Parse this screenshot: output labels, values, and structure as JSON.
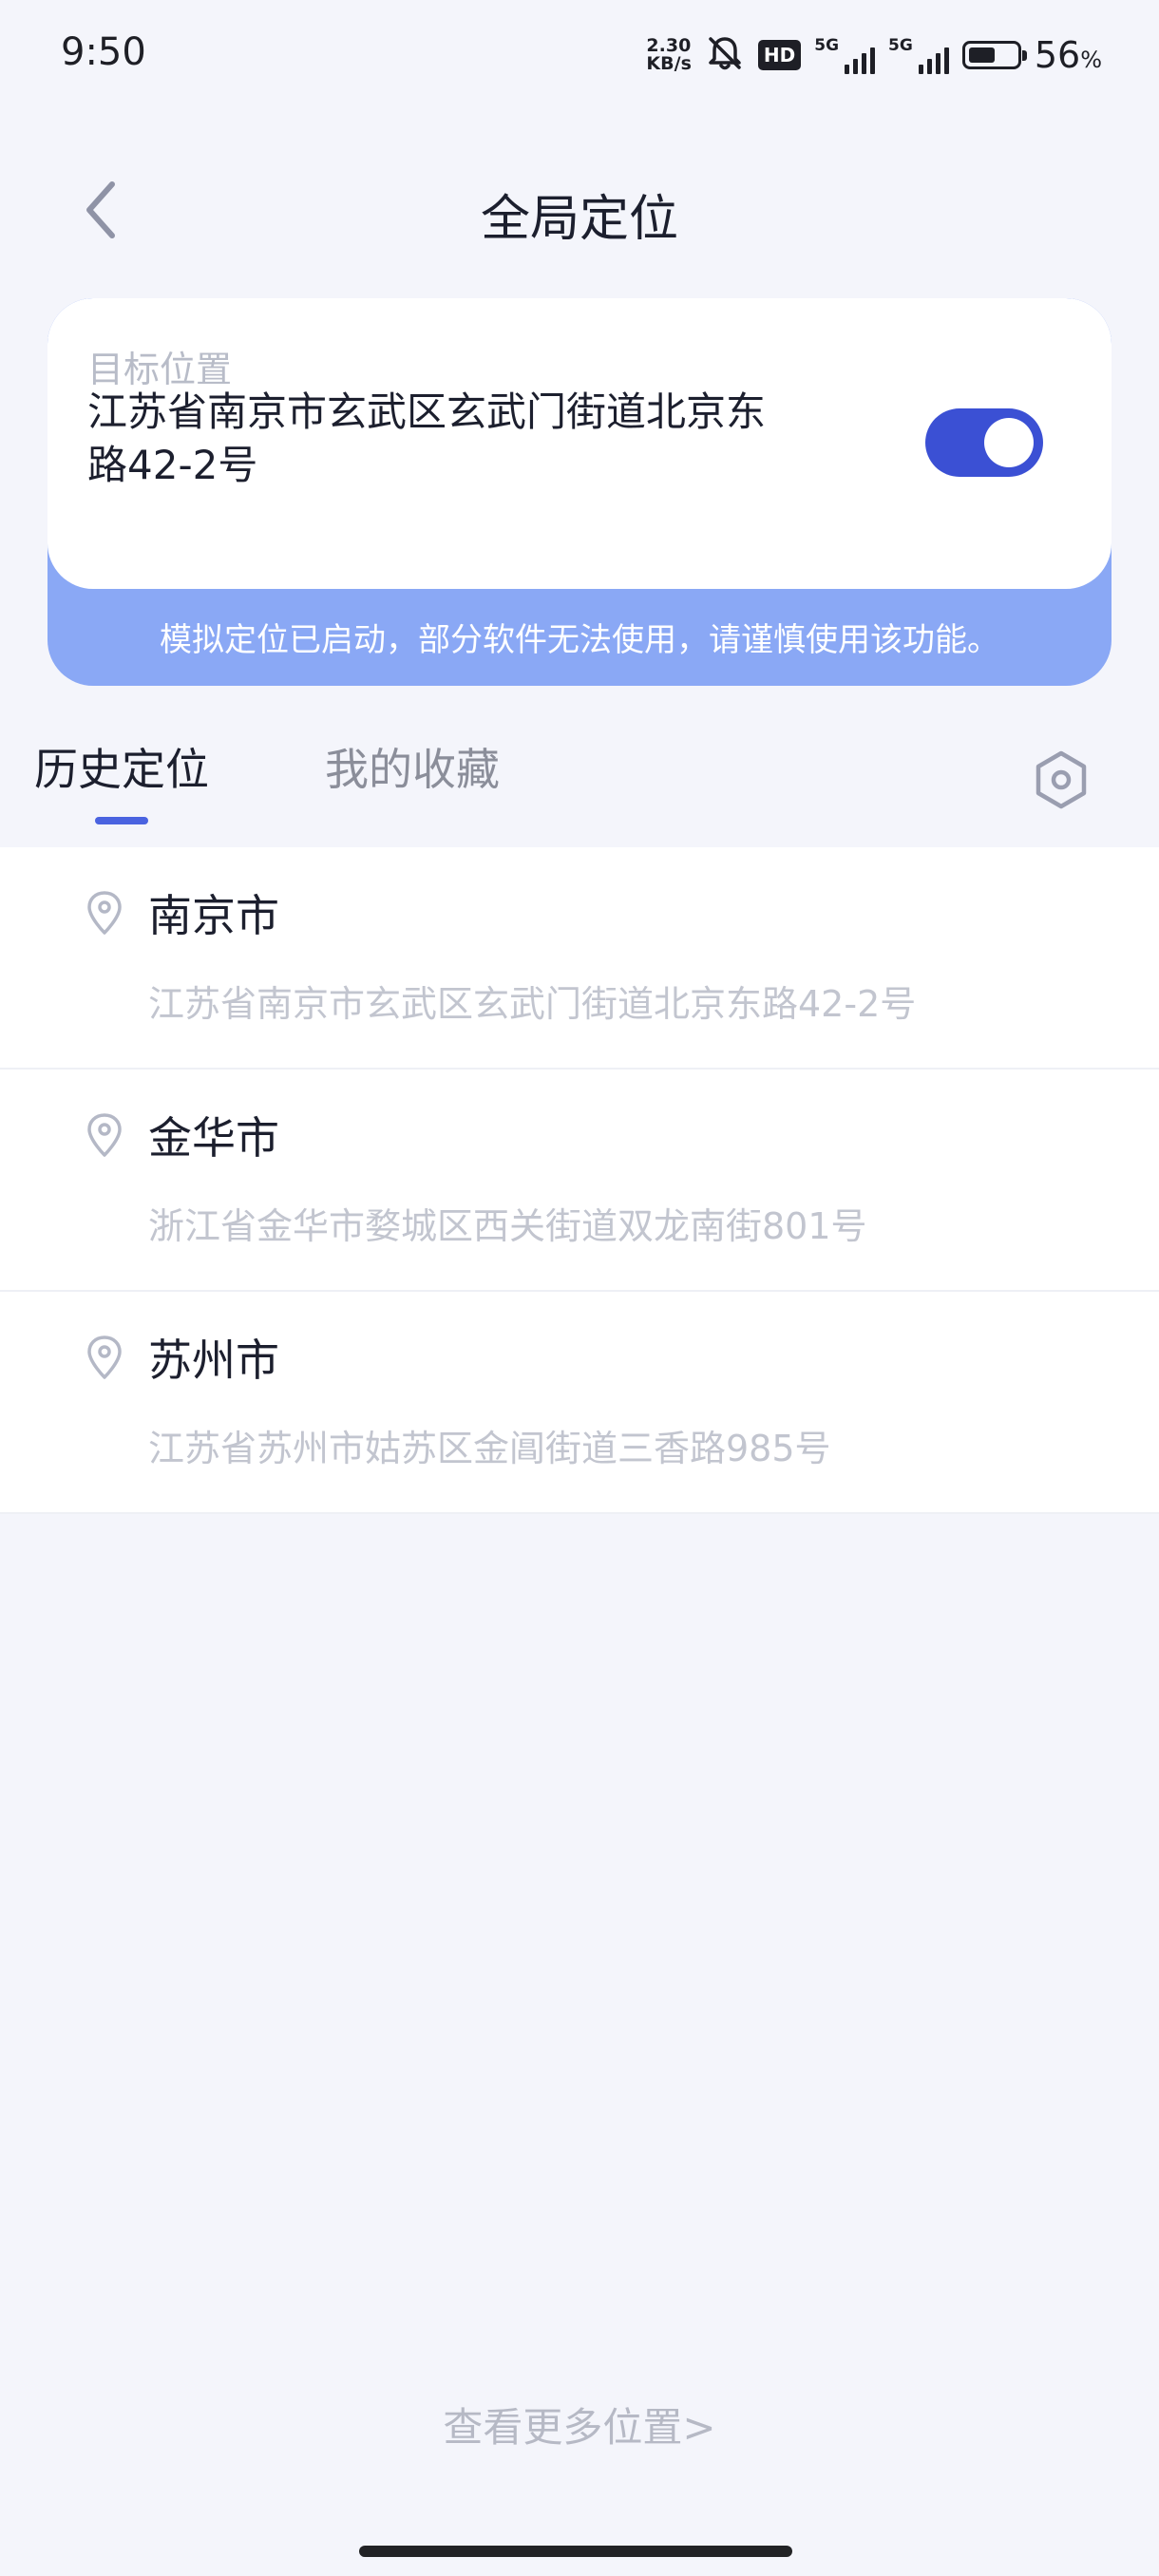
{
  "status_bar": {
    "time": "9:50",
    "net_speed_value": "2.30",
    "net_speed_unit": "KB/s",
    "hd_label": "HD",
    "sim1_label": "5G",
    "sim2_label": "5G",
    "battery_percent": "56",
    "battery_percent_sign": "%",
    "battery_level": 0.56
  },
  "header": {
    "title": "全局定位"
  },
  "target": {
    "label": "目标位置",
    "address": "江苏省南京市玄武区玄武门街道北京东路42-2号",
    "toggle_on": true,
    "warning": "模拟定位已启动，部分软件无法使用，请谨慎使用该功能。"
  },
  "tabs": {
    "history": "历史定位",
    "favorites": "我的收藏"
  },
  "history": [
    {
      "city": "南京市",
      "address": "江苏省南京市玄武区玄武门街道北京东路42-2号"
    },
    {
      "city": "金华市",
      "address": "浙江省金华市婺城区西关街道双龙南街801号"
    },
    {
      "city": "苏州市",
      "address": "江苏省苏州市姑苏区金阊街道三香路985号"
    }
  ],
  "footer": {
    "more_link": "查看更多位置>"
  },
  "colors": {
    "accent": "#3b50d4",
    "warning_bg": "#8aa8f5",
    "background": "#f4f5fb"
  },
  "icons": {
    "back": "chevron-left-icon",
    "settings": "hexagon-settings-icon",
    "pin": "location-pin-icon",
    "mute": "bell-off-icon"
  }
}
